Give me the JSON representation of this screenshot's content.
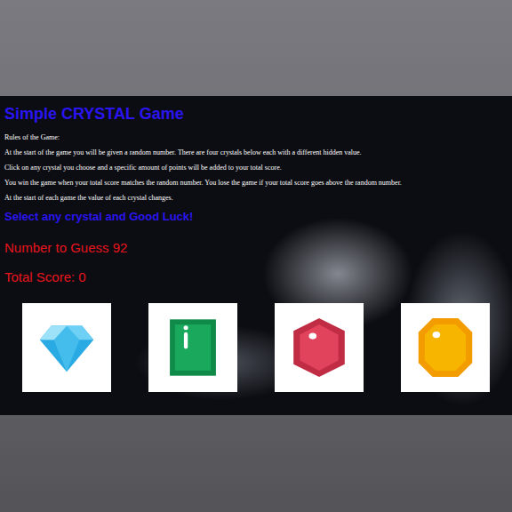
{
  "page": {
    "title": "Simple CRYSTAL Game"
  },
  "rules": {
    "heading": "Rules of the Game:",
    "lines": [
      "At the start of the game you will be given a random number. There are four crystals below each with a different hidden value.",
      "Click on any crystal you choose and a specific amount of points will be added to your total score.",
      "You win the game when your total score matches the random number. You lose the game if your total score goes above the random number.",
      "At the start of each game the value of each crystal changes."
    ]
  },
  "prompt": "Select any crystal and Good Luck!",
  "target": {
    "label": "Number to Guess 92"
  },
  "score": {
    "label": "Total Score: 0"
  },
  "crystals": [
    {
      "kind": "diamond",
      "color": "#2aaae2"
    },
    {
      "kind": "emerald",
      "color": "#1aa85c"
    },
    {
      "kind": "ruby",
      "color": "#e2435c"
    },
    {
      "kind": "topaz",
      "color": "#f7b500"
    }
  ]
}
